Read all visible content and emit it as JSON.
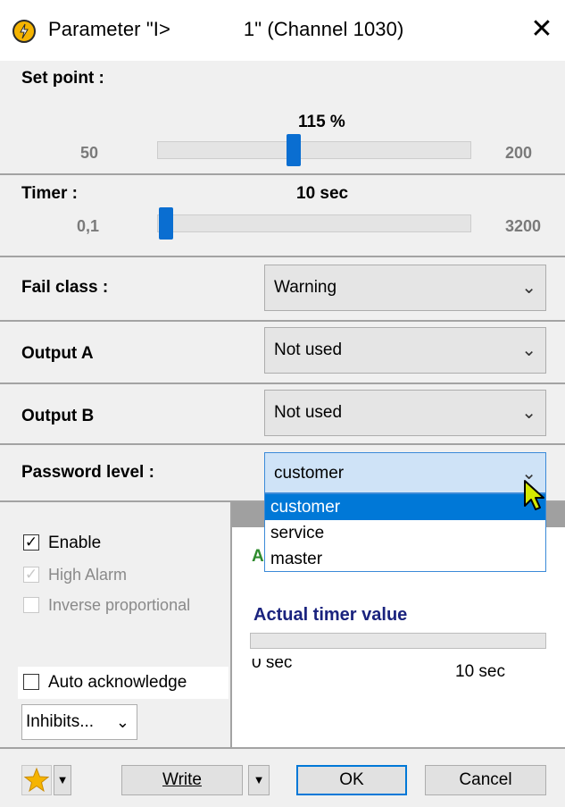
{
  "window": {
    "title_left": "Parameter \"I>",
    "title_right": "1\" (Channel 1030)",
    "close_glyph": "✕"
  },
  "setpoint": {
    "label": "Set point :",
    "value": "115 %",
    "min": "50",
    "max": "200",
    "level_fraction": 0.43
  },
  "timer": {
    "label": "Timer :",
    "value": "10 sec",
    "min": "0,1",
    "max": "3200",
    "level_fraction": 0.0
  },
  "fail_class": {
    "label": "Fail class :",
    "value": "Warning"
  },
  "output_a": {
    "label": "Output A",
    "value": "Not used"
  },
  "output_b": {
    "label": "Output B",
    "value": "Not used"
  },
  "password_level": {
    "label": "Password level :",
    "value": "customer",
    "options": [
      "customer",
      "service",
      "master"
    ],
    "selected_index": 0
  },
  "checks": {
    "enable": {
      "label": "Enable",
      "checked": true,
      "disabled": false
    },
    "high_alarm": {
      "label": "High Alarm",
      "checked": true,
      "disabled": true
    },
    "inverse": {
      "label": "Inverse proportional",
      "checked": false,
      "disabled": true
    },
    "auto_ack": {
      "label": "Auto acknowledge",
      "checked": false,
      "disabled": false
    }
  },
  "right_panel": {
    "partial_heading": "A",
    "actual_timer_label": "Actual timer value",
    "timer_left": "0 sec",
    "timer_right": "10 sec",
    "progress": 0.0
  },
  "inhibits": {
    "label": "Inhibits..."
  },
  "footer": {
    "write_label": "Write",
    "ok_label": "OK",
    "cancel_label": "Cancel"
  },
  "colors": {
    "accent": "#0a6ed1",
    "heading_blue": "#1a237e",
    "green_text": "#2e8b2e"
  },
  "icons": {
    "app": "power-icon",
    "close": "close-icon",
    "caret": "chevron-down-icon",
    "favorite": "star-icon"
  }
}
